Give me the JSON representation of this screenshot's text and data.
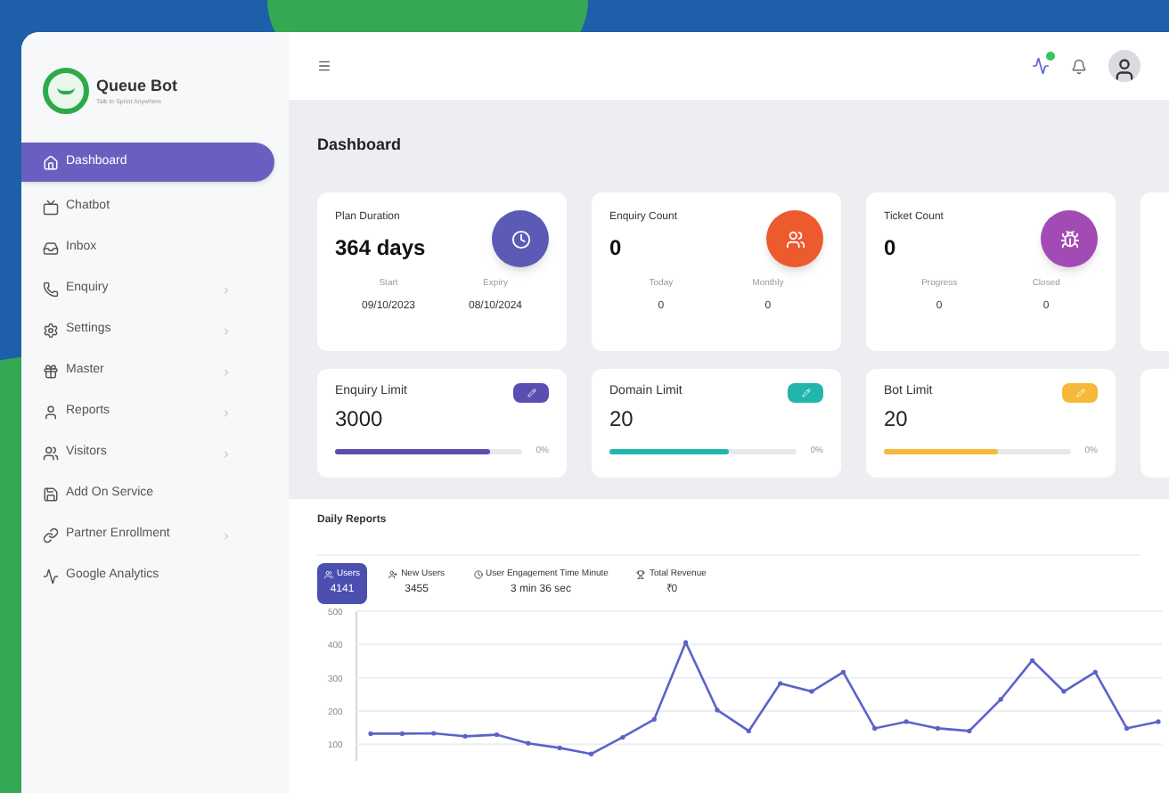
{
  "brand": {
    "name": "Queue Bot",
    "tagline": "Talk to Sprint Anywhere"
  },
  "sidebar": {
    "items": [
      {
        "label": "Dashboard",
        "selected": true,
        "has_submenu": false
      },
      {
        "label": "Chatbot",
        "selected": false,
        "has_submenu": false
      },
      {
        "label": "Inbox",
        "selected": false,
        "has_submenu": false
      },
      {
        "label": "Enquiry",
        "selected": false,
        "has_submenu": true
      },
      {
        "label": "Settings",
        "selected": false,
        "has_submenu": true
      },
      {
        "label": "Master",
        "selected": false,
        "has_submenu": true
      },
      {
        "label": "Reports",
        "selected": false,
        "has_submenu": true
      },
      {
        "label": "Visitors",
        "selected": false,
        "has_submenu": true
      },
      {
        "label": "Add On Service",
        "selected": false,
        "has_submenu": false
      },
      {
        "label": "Partner Enrollment",
        "selected": false,
        "has_submenu": true
      },
      {
        "label": "Google Analytics",
        "selected": false,
        "has_submenu": false
      }
    ]
  },
  "topbar": {
    "notification_dot": true
  },
  "page_title": "Dashboard",
  "stat_cards": [
    {
      "title": "Plan Duration",
      "value": "364 days",
      "color": "#5b5bb5",
      "sub": [
        {
          "label": "Start",
          "value": "09/10/2023"
        },
        {
          "label": "Expiry",
          "value": "08/10/2024"
        }
      ]
    },
    {
      "title": "Enquiry Count",
      "value": "0",
      "color": "#ec5a2e",
      "sub": [
        {
          "label": "Today",
          "value": "0"
        },
        {
          "label": "Monthly",
          "value": "0"
        }
      ]
    },
    {
      "title": "Ticket Count",
      "value": "0",
      "color": "#a24bb5",
      "sub": [
        {
          "label": "Progress",
          "value": "0"
        },
        {
          "label": "Closed",
          "value": "0"
        }
      ]
    }
  ],
  "limit_cards": [
    {
      "title": "Enquiry Limit",
      "value": "3000",
      "color": "#5a4fb0",
      "level": 0.83,
      "percent": "0%"
    },
    {
      "title": "Domain Limit",
      "value": "20",
      "color": "#22b5ae",
      "level": 0.64,
      "percent": "0%"
    },
    {
      "title": "Bot Limit",
      "value": "20",
      "color": "#f6b93b",
      "level": 0.61,
      "percent": "0%"
    }
  ],
  "daily_reports": {
    "title": "Daily Reports",
    "metrics": [
      {
        "label": "Users",
        "value": "4141",
        "selected": true
      },
      {
        "label": "New Users",
        "value": "3455",
        "selected": false
      },
      {
        "label": "User Engagement Time Minute",
        "value": "3 min 36 sec",
        "selected": false
      },
      {
        "label": "Total Revenue",
        "value": "₹0",
        "selected": false
      }
    ],
    "chart_data": {
      "type": "line",
      "grid": true,
      "ylim": [
        50,
        500
      ],
      "yticks": [
        100,
        200,
        300,
        400,
        500
      ],
      "series": [
        {
          "color": "#5b63c9",
          "values": [
            132,
            132,
            133,
            124,
            129,
            103,
            89,
            71,
            121,
            175,
            406,
            203,
            140,
            283,
            259,
            317,
            148,
            168,
            148,
            140,
            235,
            352,
            259,
            317,
            148,
            168
          ]
        }
      ]
    }
  }
}
